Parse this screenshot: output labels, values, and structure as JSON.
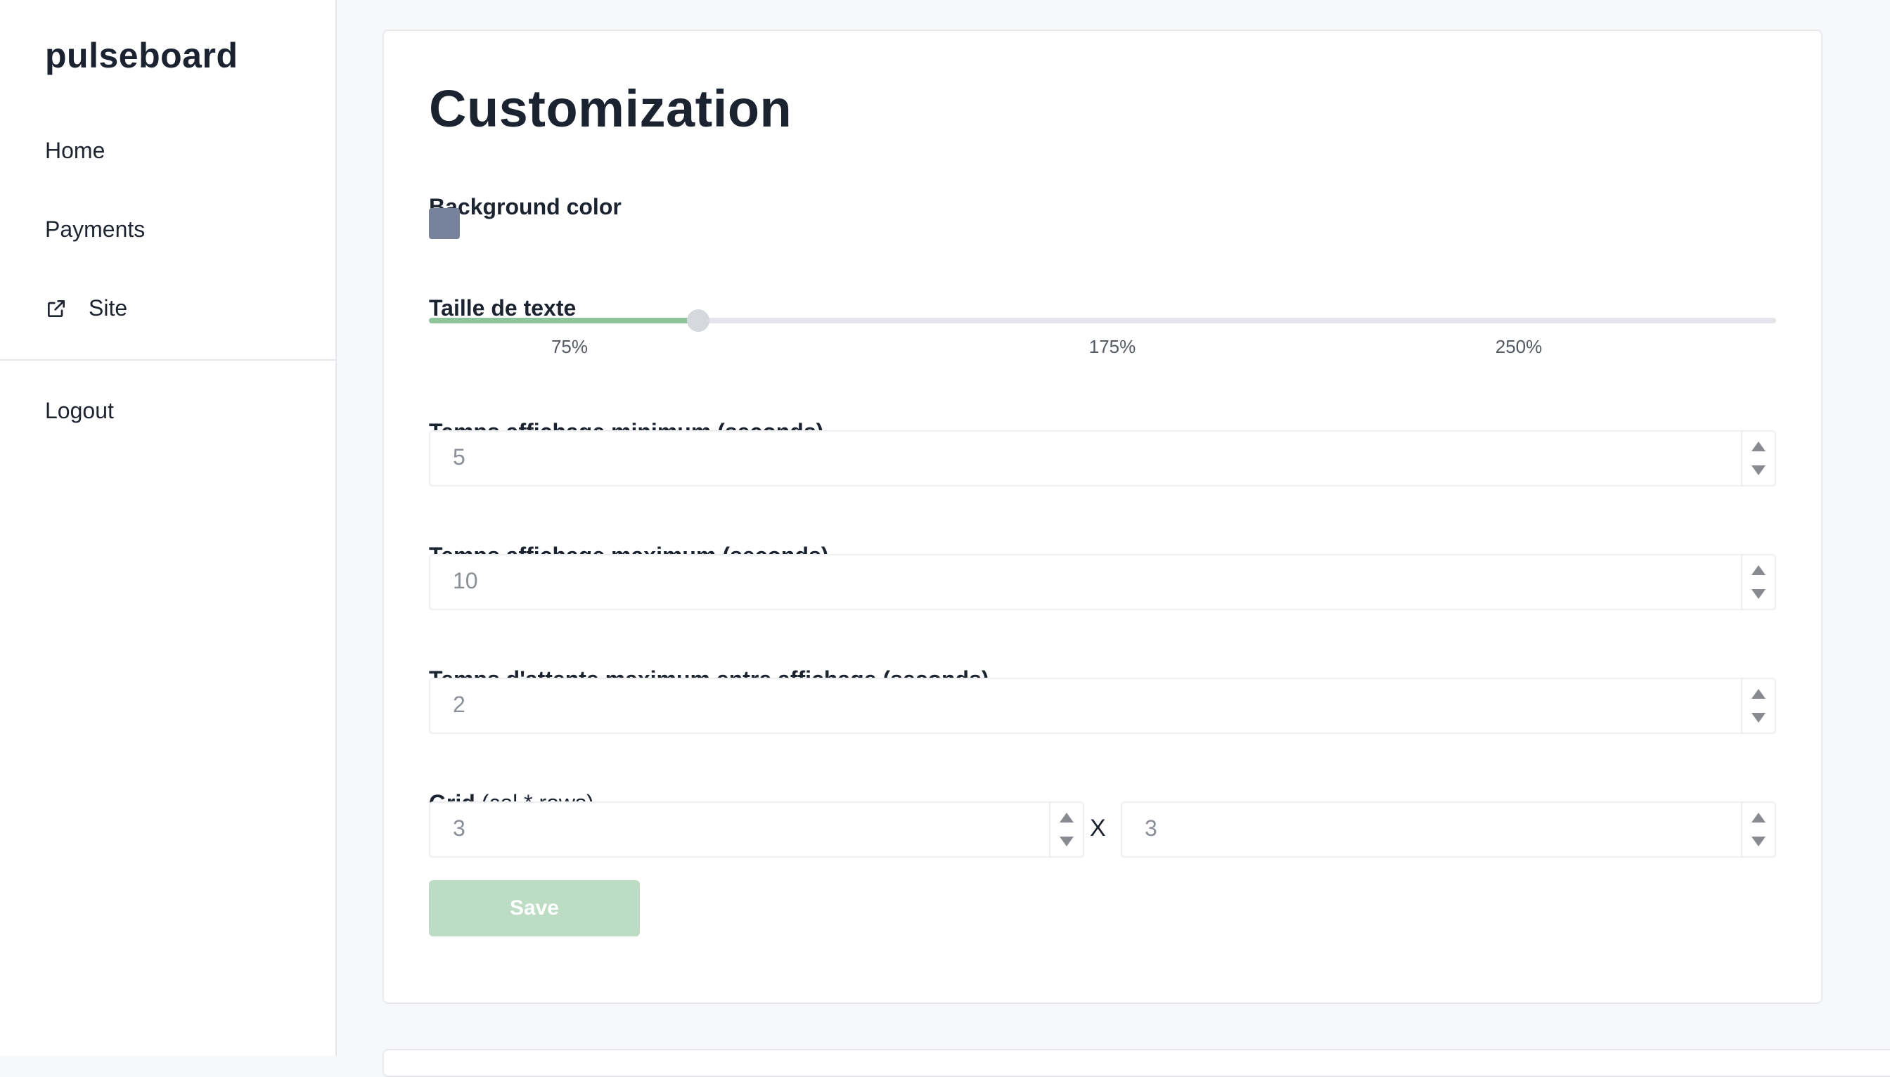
{
  "app": {
    "brand": "pulseboard"
  },
  "sidebar": {
    "items": [
      {
        "label": "Home"
      },
      {
        "label": "Payments"
      },
      {
        "label": "Site"
      }
    ],
    "logout": "Logout"
  },
  "form": {
    "title": "Customization",
    "background": {
      "label": "Background color",
      "color": "#77839a"
    },
    "text_size": {
      "label": "Taille de texte",
      "value_percent": 20,
      "ticks": [
        "75%",
        "175%",
        "250%"
      ],
      "fill_color": "#8fc59a"
    },
    "min_display": {
      "label": "Temps affichage minimum (seconds)",
      "value": "5"
    },
    "max_display": {
      "label": "Temps affichage maximum (seconds)",
      "value": "10"
    },
    "max_wait": {
      "label": "Temps d'attente maximum entre affichage (seconds)",
      "value": "2"
    },
    "grid": {
      "label": "Grid",
      "hint": "(col * rows)",
      "cols": "3",
      "rows": "3",
      "separator": "X"
    },
    "save": {
      "label": "Save",
      "color": "#bcdcc4"
    }
  }
}
